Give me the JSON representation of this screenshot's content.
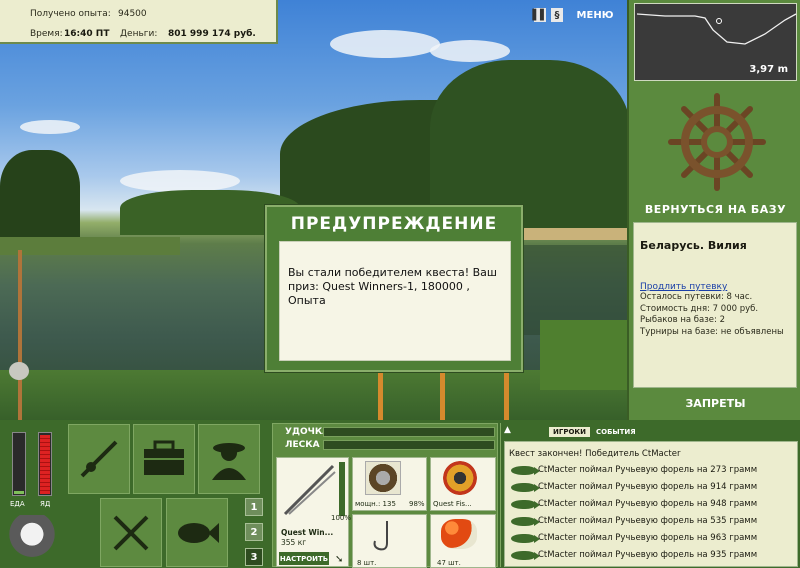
{
  "info": {
    "exp_label": "Получено опыта:",
    "exp_value": "94500",
    "time_label": "Время:",
    "time_value": "16:40 ПТ",
    "money_label": "Деньги:",
    "money_value": "801 999 174 руб."
  },
  "topbar": {
    "pause_icon": "pause-icon",
    "sound_icon": "sound-icon",
    "menu_label": "МЕНЮ"
  },
  "map": {
    "distance": "3,97 m"
  },
  "base": {
    "return_label": "ВЕРНУТЬСЯ НА БАЗУ"
  },
  "lake": {
    "title": "Беларусь. Вилия",
    "extend_link": "Продлить путевку",
    "lines": [
      "Осталось путевки: 8 час.",
      "Стоимость дня: 7 000 руб.",
      "Рыбаков на базе: 2",
      "Турниры на базе: не объявлены"
    ]
  },
  "bans": {
    "label": "ЗАПРЕТЫ"
  },
  "dialog": {
    "title": "ПРЕДУПРЕЖДЕНИЕ",
    "message": "Вы стали победителем квеста! Ваш приз: Quest Winners-1, 180000 , Опыта"
  },
  "gauges": {
    "food_label": "ЕДА",
    "poison_label": "ЯД",
    "food_level": 0.05,
    "poison_level": 0.95
  },
  "slots": [
    "1",
    "2",
    "3"
  ],
  "tackle": {
    "rod_label": "УДОЧКА",
    "line_label": "ЛЕСКА",
    "rod_name": "Quest Win...",
    "rod_weight": "355 кг",
    "rod_percent": "100%",
    "setup_button": "НАСТРОИТЬ",
    "reel_power": "мощн.: 135",
    "reel_percent": "98%",
    "line_name": "Quest Fis...",
    "hook_count": "8 шт.",
    "bait_count": "47 шт."
  },
  "events": {
    "tab_players": "ИГРОКИ",
    "tab_events": "СОБЫТИЯ",
    "header": "Квест закончен! Победитель CtMacter",
    "items": [
      "CtMacter поймал Ручьевую форель на 273 грамм",
      "CtMacter поймал Ручьевую форель на 914 грамм",
      "CtMacter поймал Ручьевую форель на 948 грамм",
      "CtMacter поймал Ручьевую форель на 535 грамм",
      "CtMacter поймал Ручьевую форель на 963 грамм",
      "CtMacter поймал Ручьевую форель на 935 грамм"
    ]
  }
}
